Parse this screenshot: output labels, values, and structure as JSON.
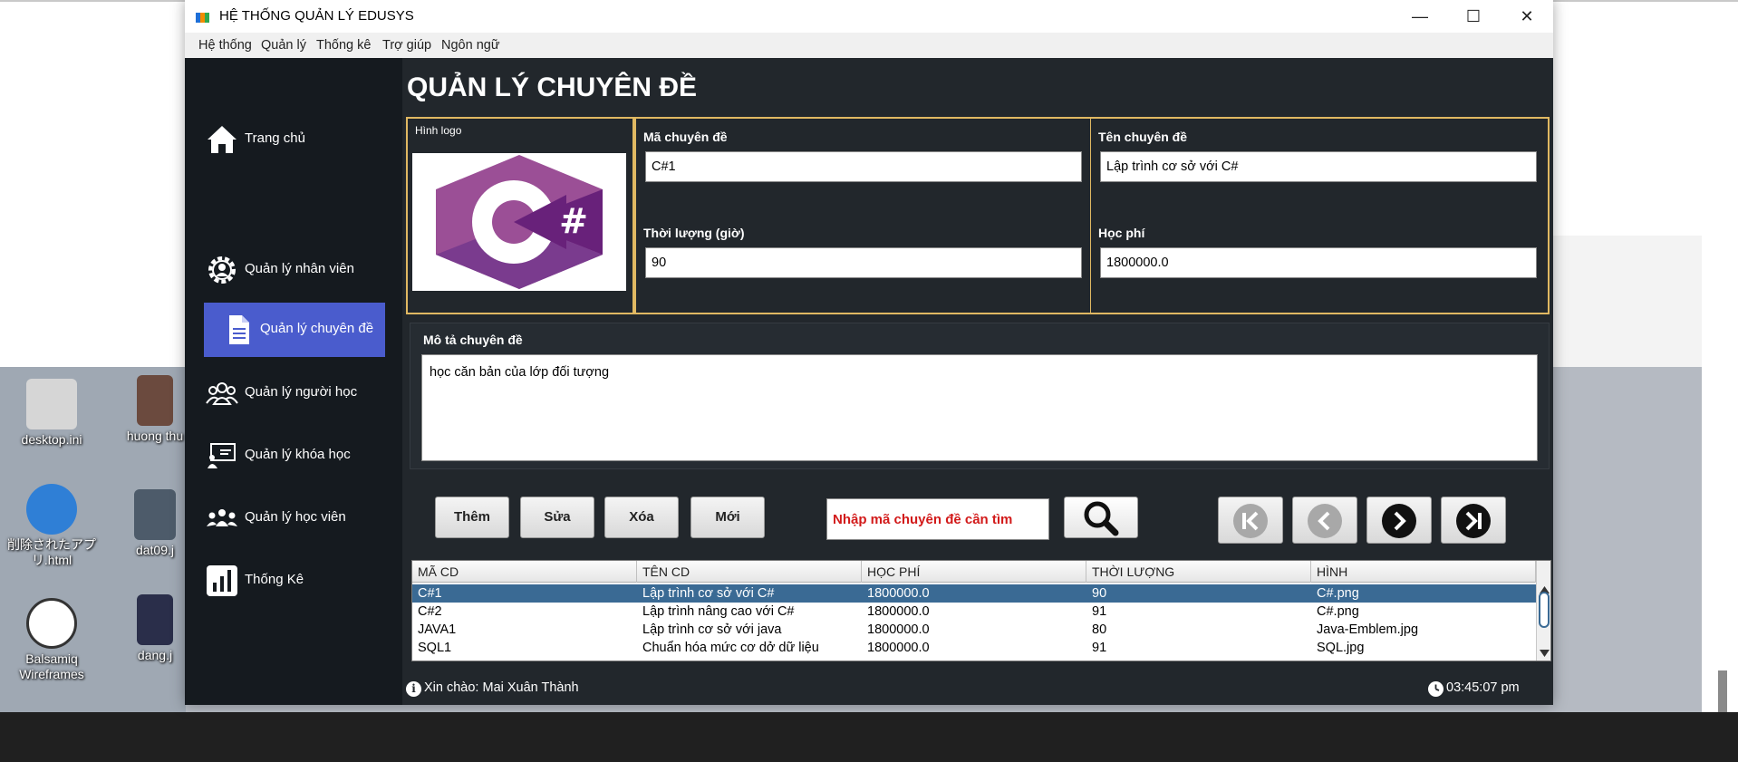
{
  "window": {
    "title": "HỆ THỐNG QUẢN LÝ EDUSYS",
    "minimize": "—",
    "maximize": "☐",
    "close": "✕"
  },
  "menubar": [
    "Hệ thống",
    "Quản lý",
    "Thống kê",
    "Trợ giúp",
    "Ngôn ngữ"
  ],
  "sidebar": {
    "items": [
      {
        "label": "Trang chủ",
        "icon": "home-icon"
      },
      {
        "label": "Quản lý nhân viên",
        "icon": "gear-user-icon"
      },
      {
        "label": "Quản lý chuyên đề",
        "icon": "document-icon",
        "active": true
      },
      {
        "label": "Quản lý người học",
        "icon": "group-icon"
      },
      {
        "label": "Quản lý khóa học",
        "icon": "presentation-icon"
      },
      {
        "label": "Quản lý học viên",
        "icon": "team-icon"
      },
      {
        "label": "Thống Kê",
        "icon": "bar-chart-icon"
      }
    ]
  },
  "page": {
    "title": "QUẢN LÝ CHUYÊN ĐỀ"
  },
  "form": {
    "logo_caption": "Hình logo",
    "logo_text": "#",
    "ma_label": "Mã chuyên đề",
    "ma_value": "C#1",
    "ten_label": "Tên chuyên đề",
    "ten_value": "Lập trình cơ sở với C#",
    "thoiluong_label": "Thời lượng (giờ)",
    "thoiluong_value": "90",
    "hocphi_label": "Học phí",
    "hocphi_value": "1800000.0",
    "mota_label": "Mô tả chuyên đề",
    "mota_value": "học căn bản của lớp đối tượng"
  },
  "actions": {
    "them": "Thêm",
    "sua": "Sửa",
    "xoa": "Xóa",
    "moi": "Mới"
  },
  "search": {
    "value": "Nhập mã chuyên đề cần tìm"
  },
  "table": {
    "columns": [
      "MÃ CD",
      "TÊN CD",
      "HỌC PHÍ",
      "THỜI LƯỢNG",
      "HÌNH"
    ],
    "rows": [
      [
        "C#1",
        "Lập trình cơ sở với C#",
        "1800000.0",
        "90",
        "C#.png"
      ],
      [
        "C#2",
        "Lập trình nâng cao với C#",
        "1800000.0",
        "91",
        "C#.png"
      ],
      [
        "JAVA1",
        "Lập trình cơ sở với java",
        "1800000.0",
        "80",
        "Java-Emblem.jpg"
      ],
      [
        "SQL1",
        "Chuẩn hóa mức cơ dở dữ liệu",
        "1800000.0",
        "91",
        "SQL.jpg"
      ]
    ],
    "selected_row": 0
  },
  "status": {
    "greeting": "Xin chào: Mai Xuân Thành",
    "time": "03:45:07 pm"
  },
  "desktop": {
    "icons": [
      {
        "label": "desktop.ini"
      },
      {
        "label": "huong thu"
      },
      {
        "label": "削除されたアプリ.html"
      },
      {
        "label": "dat09.j"
      },
      {
        "label": "Balsamiq Wireframes"
      },
      {
        "label": "dang.j"
      }
    ]
  },
  "colors": {
    "sidebar_bg": "#151a1f",
    "main_bg": "#22272c",
    "active_nav": "#4a5ccd",
    "panel_border": "#e0b862",
    "selected_row": "#3a6a94",
    "search_text": "#d21a1a"
  }
}
